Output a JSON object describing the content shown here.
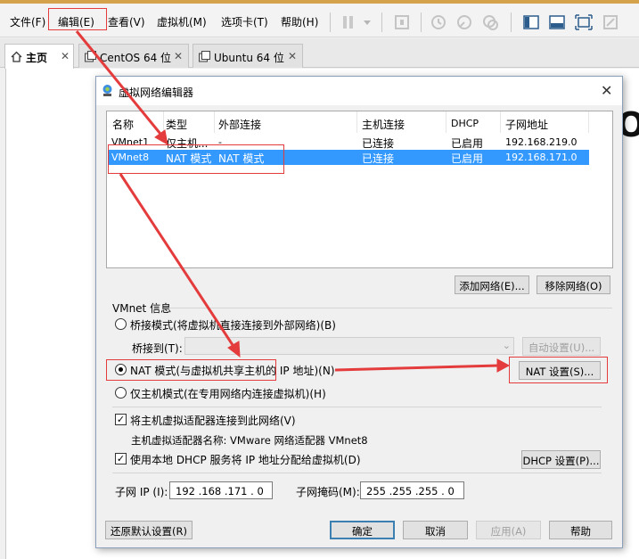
{
  "menubar": {
    "items": [
      "文件(F)",
      "编辑(E)",
      "查看(V)",
      "虚拟机(M)",
      "选项卡(T)",
      "帮助(H)"
    ]
  },
  "toolbar": {
    "icons": [
      "pause-icon",
      "dropdown-icon",
      "network-icon",
      "snapshot-icon",
      "snapshot-revert-icon",
      "snapshot-manager-icon",
      "console-view-icon",
      "quick-switch-icon",
      "fullscreen-icon",
      "unity-icon"
    ]
  },
  "tabs": [
    {
      "label": "主页",
      "active": true
    },
    {
      "label": "CentOS 64 位",
      "active": false
    },
    {
      "label": "Ubuntu 64 位",
      "active": false
    }
  ],
  "background_text": "O",
  "dialog": {
    "title": "虚拟网络编辑器",
    "table": {
      "headers": [
        "名称",
        "类型",
        "外部连接",
        "主机连接",
        "DHCP",
        "子网地址"
      ],
      "rows": [
        [
          "VMnet1",
          "仅主机...",
          "-",
          "已连接",
          "已启用",
          "192.168.219.0"
        ],
        [
          "VMnet8",
          "NAT 模式",
          "NAT 模式",
          "已连接",
          "已启用",
          "192.168.171.0"
        ]
      ],
      "selected_row": 1
    },
    "add_network": "添加网络(E)...",
    "remove_network": "移除网络(O)",
    "vmnet_info_label": "VMnet 信息",
    "bridge_mode": "桥接模式(将虚拟机直接连接到外部网络)(B)",
    "bridge_to_label": "桥接到(T):",
    "bridge_to_value": "",
    "auto_settings": "自动设置(U)...",
    "nat_mode": "NAT 模式(与虚拟机共享主机的 IP 地址)(N)",
    "nat_settings": "NAT 设置(S)...",
    "host_only_mode": "仅主机模式(在专用网络内连接虚拟机)(H)",
    "selected_mode": "nat",
    "connect_adapter": "将主机虚拟适配器连接到此网络(V)",
    "connect_adapter_checked": true,
    "adapter_name": "主机虚拟适配器名称: VMware 网络适配器 VMnet8",
    "use_dhcp": "使用本地 DHCP 服务将 IP 地址分配给虚拟机(D)",
    "use_dhcp_checked": true,
    "dhcp_settings": "DHCP 设置(P)...",
    "subnet_ip_label": "子网 IP (I):",
    "subnet_ip": "192 .168 .171 .  0",
    "subnet_mask_label": "子网掩码(M):",
    "subnet_mask": "255 .255 .255 .  0",
    "restore_defaults": "还原默认设置(R)",
    "ok": "确定",
    "cancel": "取消",
    "apply": "应用(A)",
    "help": "帮助"
  },
  "annotation_color": "#e43c3c",
  "selection_color": "#3399ff"
}
